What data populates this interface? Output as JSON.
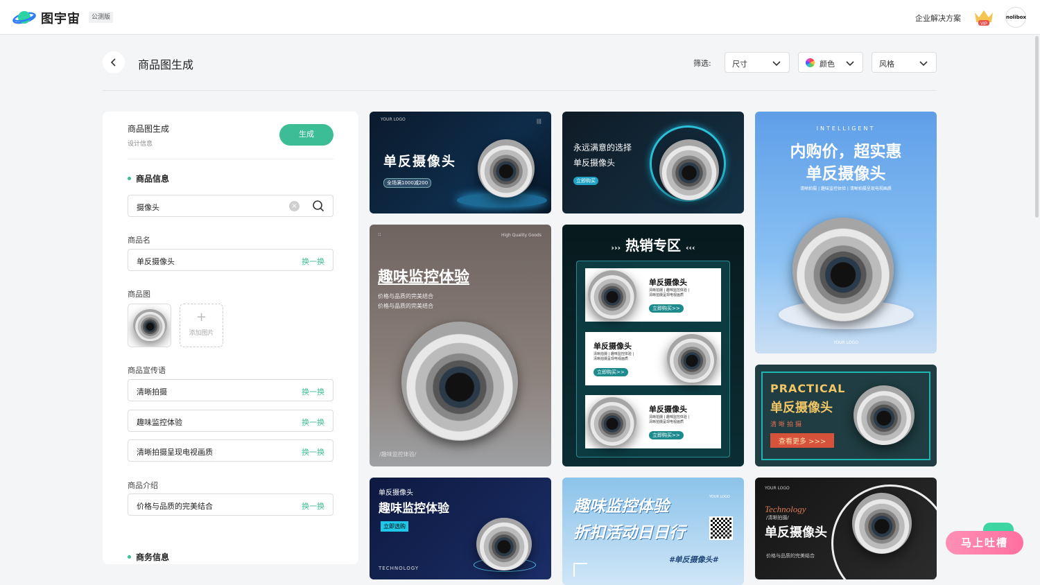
{
  "header": {
    "brand": "图宇宙",
    "beta": "公测版",
    "enterprise": "企业解决方案",
    "vip": "VIP",
    "avatar": "nolibox"
  },
  "page": {
    "title": "商品图生成",
    "filter_label": "筛选:",
    "filters": [
      {
        "label": "尺寸"
      },
      {
        "label": "颜色"
      },
      {
        "label": "风格"
      }
    ]
  },
  "panel": {
    "title": "商品图生成",
    "subtitle": "设计信息",
    "generate": "生成",
    "section_product": "商品信息",
    "search_value": "摄像头",
    "name_label": "商品名",
    "name_value": "单反摄像头",
    "swap": "换一换",
    "image_label": "商品图",
    "add_image": "添加图片",
    "slogan_label": "商品宣传语",
    "slogans": [
      "清晰拍摄",
      "趣味监控体验",
      "清晰拍摄呈现电视画质"
    ],
    "intro_label": "商品介绍",
    "intro_value": "价格与品质的完美结合",
    "section_business": "商务信息"
  },
  "cards": {
    "c1": {
      "logo": "YOUR LOGO",
      "title": "单反摄像头",
      "badge": "全场满1000减200"
    },
    "c2": {
      "line1": "永远满意的选择",
      "line2": "单反摄像头",
      "btn": "立即购买"
    },
    "c3": {
      "top": "INTELLIGENT",
      "title1": "内购价，超实惠",
      "title2": "单反摄像头",
      "sub": "清晰拍摄 | 趣味监控体验 | 清晰拍摄呈现电视画质",
      "logo": "YOUR LOGO"
    },
    "c4": {
      "corner": "High Quality Goods",
      "title": "趣味监控体验",
      "line1": "价格与品质的完美结合",
      "line2": "价格与品质的完美结合",
      "footer": "/趣味监控体验/"
    },
    "c5": {
      "title": "热销专区",
      "item_title": "单反摄像头",
      "item_sub1": "清晰拍摄 | 趣味监控体验 |",
      "item_sub2": "清晰拍摄呈现电视画质",
      "item_btn": "立即购买>>"
    },
    "c6": {
      "top": "PRACTICAL",
      "title": "单反摄像头",
      "sub": "清晰拍摄",
      "btn": "查看更多 >>>"
    },
    "c7": {
      "small": "单反摄像头",
      "title": "趣味监控体验",
      "btn": "立即选购",
      "footer": "TECHNOLOGY"
    },
    "c8": {
      "line1": "趣味监控体验",
      "line2": "折扣活动日日行",
      "tag": "#单反摄像头#",
      "logo": "YOUR LOGO"
    },
    "c9": {
      "logo": "YOUR LOGO",
      "script": "Technology",
      "small": "/清晰拍摄/",
      "title": "单反摄像头",
      "sub": "价格与品质的完美结合"
    }
  },
  "feedback": "马上吐槽"
}
